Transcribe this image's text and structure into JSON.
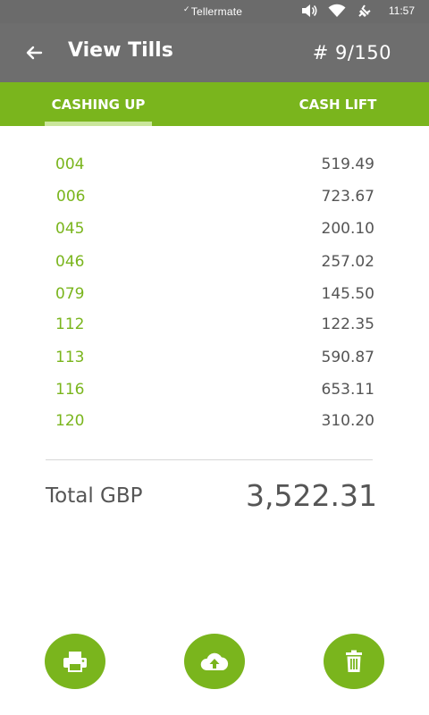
{
  "status_bar": {
    "brand": "Tellermate",
    "time": "11:57",
    "icons": [
      "volume-icon",
      "wifi-icon",
      "charging-icon"
    ]
  },
  "header": {
    "title": "View Tills",
    "counter": "# 9/150"
  },
  "tabs": [
    {
      "label": "CASHING UP",
      "active": true
    },
    {
      "label": "CASH LIFT",
      "active": false
    }
  ],
  "tills": [
    {
      "id": "004",
      "amount": "519.49"
    },
    {
      "id": "006",
      "amount": "723.67"
    },
    {
      "id": "045",
      "amount": "200.10"
    },
    {
      "id": "046",
      "amount": "257.02"
    },
    {
      "id": "079",
      "amount": "145.50"
    },
    {
      "id": "112",
      "amount": "122.35"
    },
    {
      "id": "113",
      "amount": "590.87"
    },
    {
      "id": "116",
      "amount": "653.11"
    },
    {
      "id": "120",
      "amount": "310.20"
    }
  ],
  "total": {
    "label": "Total GBP",
    "value": "3,522.31"
  },
  "actions": [
    "print-icon",
    "cloud-upload-icon",
    "trash-icon"
  ],
  "colors": {
    "accent": "#7ab51d",
    "header": "#6e6e6e",
    "text": "#555555"
  }
}
